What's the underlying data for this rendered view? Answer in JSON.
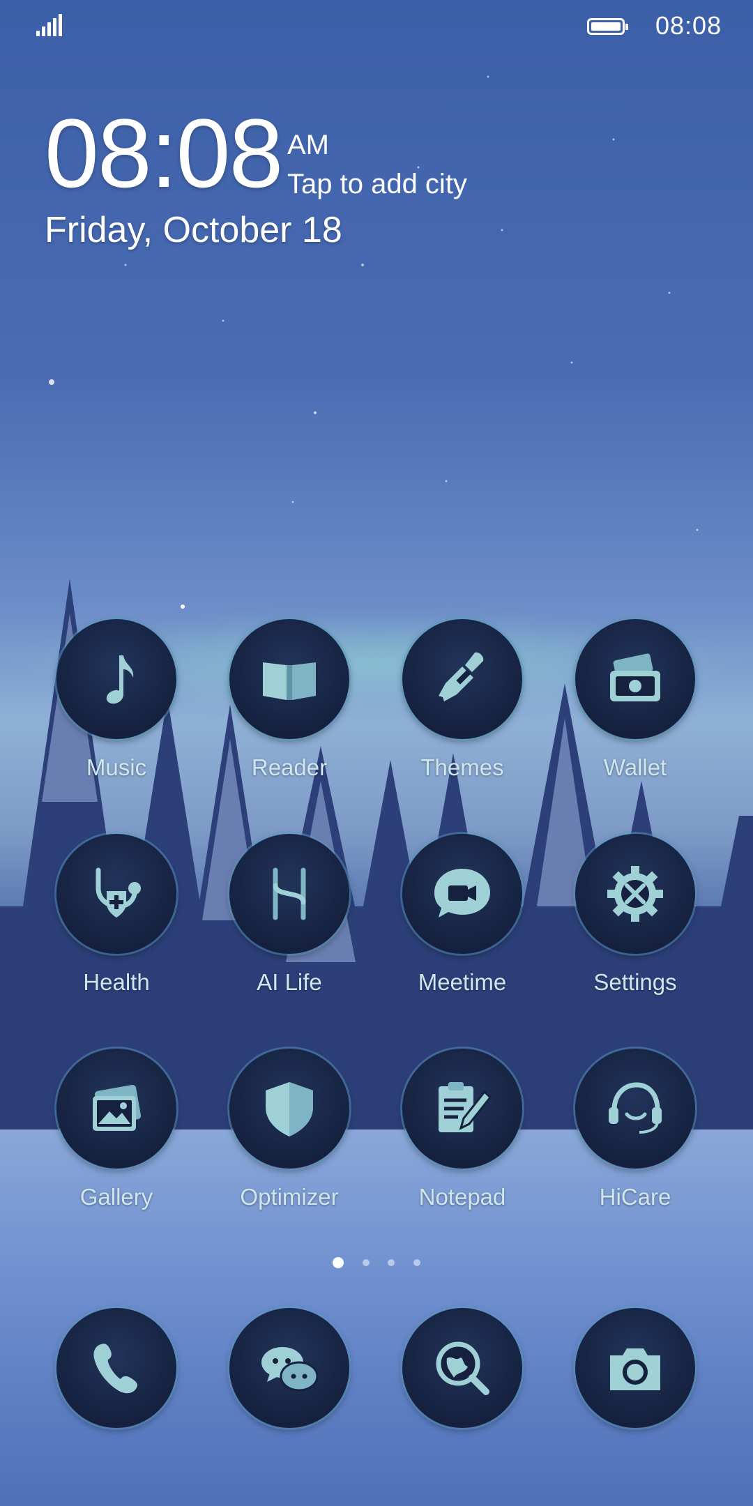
{
  "status_bar": {
    "time": "08:08",
    "battery_level": 1.0
  },
  "clock_widget": {
    "time": "08:08",
    "ampm": "AM",
    "city": "Tap to add city",
    "date": "Friday, October 18"
  },
  "apps": [
    {
      "label": "Music",
      "icon": "music-note-icon"
    },
    {
      "label": "Reader",
      "icon": "book-icon"
    },
    {
      "label": "Themes",
      "icon": "paintbrush-icon"
    },
    {
      "label": "Wallet",
      "icon": "wallet-icon"
    },
    {
      "label": "Health",
      "icon": "stethoscope-icon"
    },
    {
      "label": "AI Life",
      "icon": "ai-life-icon"
    },
    {
      "label": "Meetime",
      "icon": "video-chat-icon"
    },
    {
      "label": "Settings",
      "icon": "gear-tools-icon"
    },
    {
      "label": "Gallery",
      "icon": "photos-icon"
    },
    {
      "label": "Optimizer",
      "icon": "shield-icon"
    },
    {
      "label": "Notepad",
      "icon": "notepad-icon"
    },
    {
      "label": "HiCare",
      "icon": "headset-icon"
    }
  ],
  "page_indicator": {
    "count": 4,
    "active": 1
  },
  "dock": [
    {
      "icon": "phone-icon"
    },
    {
      "icon": "chat-icon"
    },
    {
      "icon": "browser-icon"
    },
    {
      "icon": "camera-icon"
    }
  ],
  "colors": {
    "icon_glyph": "#9fd0d6",
    "icon_bg": "#15213f",
    "label": "#cfe6ee"
  }
}
